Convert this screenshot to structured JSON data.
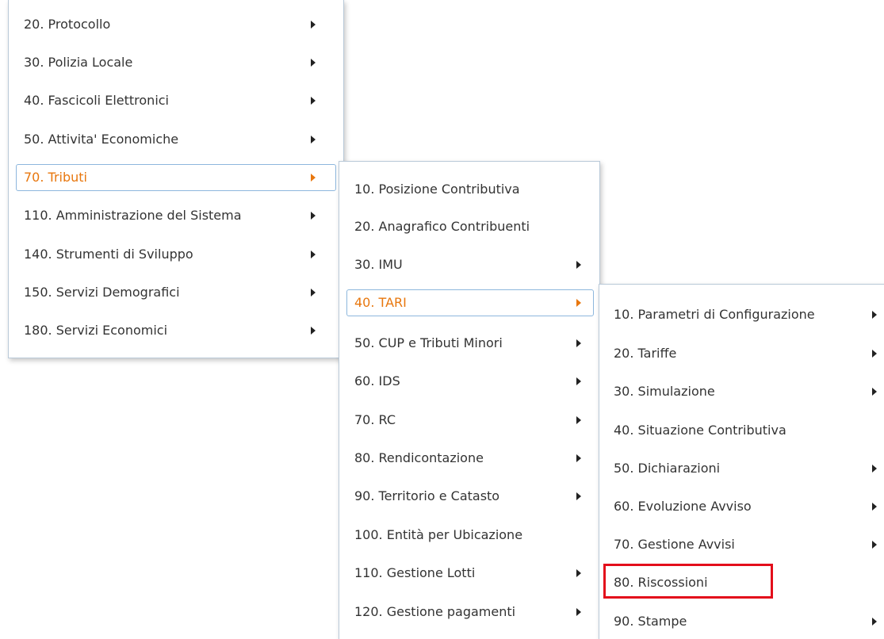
{
  "menu_level1": {
    "items": [
      {
        "label": "20. Protocollo",
        "submenu": true
      },
      {
        "label": "30. Polizia Locale",
        "submenu": true
      },
      {
        "label": "40. Fascicoli Elettronici",
        "submenu": true
      },
      {
        "label": "50. Attivita' Economiche",
        "submenu": true
      },
      {
        "label": "70. Tributi",
        "submenu": true,
        "active": true
      },
      {
        "label": "110. Amministrazione del Sistema",
        "submenu": true
      },
      {
        "label": "140. Strumenti di Sviluppo",
        "submenu": true
      },
      {
        "label": "150. Servizi Demografici",
        "submenu": true
      },
      {
        "label": "180. Servizi Economici",
        "submenu": true
      }
    ]
  },
  "menu_level2": {
    "items": [
      {
        "label": "10. Posizione Contributiva",
        "submenu": false
      },
      {
        "label": "20. Anagrafico Contribuenti",
        "submenu": false
      },
      {
        "label": "30. IMU",
        "submenu": true
      },
      {
        "label": "40. TARI",
        "submenu": true,
        "active": true
      },
      {
        "label": "50. CUP e Tributi Minori",
        "submenu": true
      },
      {
        "label": "60. IDS",
        "submenu": true
      },
      {
        "label": "70. RC",
        "submenu": true
      },
      {
        "label": "80. Rendicontazione",
        "submenu": true
      },
      {
        "label": "90. Territorio e Catasto",
        "submenu": true
      },
      {
        "label": "100. Entità per Ubicazione",
        "submenu": false
      },
      {
        "label": "110. Gestione Lotti",
        "submenu": true
      },
      {
        "label": "120. Gestione pagamenti",
        "submenu": true
      }
    ]
  },
  "menu_level3": {
    "items": [
      {
        "label": "10. Parametri di Configurazione",
        "submenu": true
      },
      {
        "label": "20. Tariffe",
        "submenu": true
      },
      {
        "label": "30. Simulazione",
        "submenu": true
      },
      {
        "label": "40. Situazione Contributiva",
        "submenu": false
      },
      {
        "label": "50. Dichiarazioni",
        "submenu": true
      },
      {
        "label": "60. Evoluzione Avviso",
        "submenu": true
      },
      {
        "label": "70. Gestione Avvisi",
        "submenu": true
      },
      {
        "label": "80. Riscossioni",
        "submenu": false,
        "highlighted": true
      },
      {
        "label": "90. Stampe",
        "submenu": true
      }
    ]
  },
  "colors": {
    "active_text": "#e8770e",
    "highlight_border": "#e30e1b",
    "menu_border": "#b9c9d8"
  }
}
